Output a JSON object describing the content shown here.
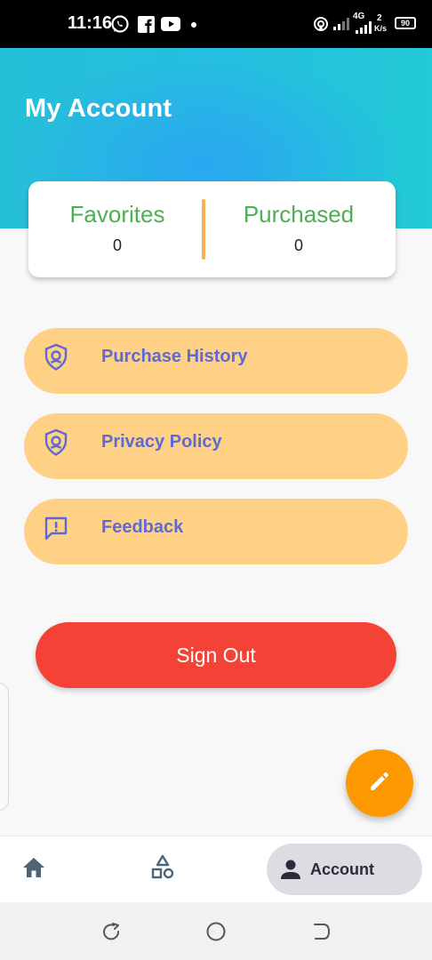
{
  "status_bar": {
    "time": "11:16",
    "icons": [
      "whatsapp-icon",
      "facebook-icon",
      "youtube-icon",
      "dot",
      "hotspot-icon",
      "signal-icon",
      "signal-4g-icon"
    ],
    "network_type": "4G",
    "speed": "2",
    "speed_unit": "K/s",
    "battery": "90"
  },
  "header": {
    "title": "My Account",
    "colors": {
      "gradient_start": "#26bfd8",
      "gradient_mid": "#2aa7f0",
      "gradient_end": "#22c9d6"
    }
  },
  "stats": {
    "favorites_label": "Favorites",
    "favorites_count": "0",
    "purchased_label": "Purchased",
    "purchased_count": "0",
    "label_color": "#4caf50",
    "divider_color": "#f4b350"
  },
  "menu": {
    "background_color": "#fed186",
    "text_color": "#5e6ad2",
    "items": [
      {
        "label": "Purchase History",
        "icon": "shield-account-icon"
      },
      {
        "label": "Privacy Policy",
        "icon": "shield-account-icon"
      },
      {
        "label": "Feedback",
        "icon": "feedback-icon"
      }
    ]
  },
  "signout": {
    "label": "Sign Out",
    "color": "#f44336"
  },
  "fab": {
    "icon": "edit-pencil-icon",
    "color": "#fe9800"
  },
  "bottom_nav": {
    "items": [
      {
        "icon": "home-icon",
        "label": ""
      },
      {
        "icon": "categories-icon",
        "label": ""
      },
      {
        "icon": "account-icon",
        "label": "Account",
        "active": true
      }
    ]
  },
  "system_nav": {
    "buttons": [
      "recents-icon",
      "home-circle-icon",
      "back-icon"
    ]
  }
}
